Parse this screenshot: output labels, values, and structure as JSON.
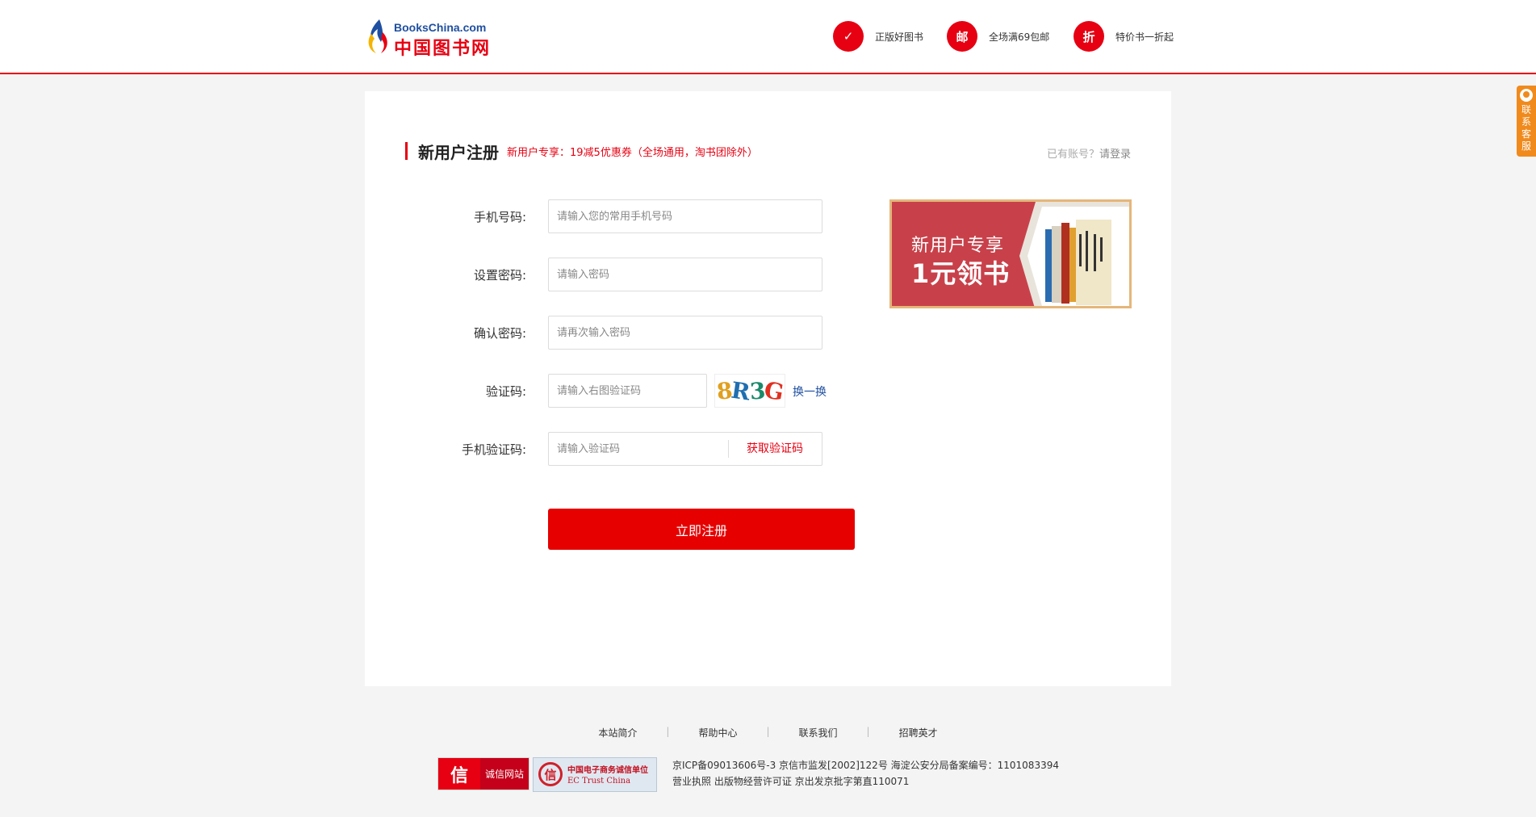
{
  "header": {
    "logo_en": "BooksChina.com",
    "logo_cn": "中国图书网",
    "features": [
      {
        "icon": "check-icon",
        "icon_text": "✓",
        "label": "正版好图书"
      },
      {
        "icon": "mail-icon",
        "icon_text": "邮",
        "label": "全场满69包邮"
      },
      {
        "icon": "discount-icon",
        "icon_text": "折",
        "label": "特价书一折起"
      }
    ]
  },
  "form": {
    "title": "新用户注册",
    "promo": "新用户专享：19减5优惠券（全场通用，淘书团除外）",
    "login_prefix": "已有账号？",
    "login_link": "请登录",
    "fields": {
      "phone": {
        "label": "手机号码:",
        "placeholder": "请输入您的常用手机号码"
      },
      "password": {
        "label": "设置密码:",
        "placeholder": "请输入密码"
      },
      "confirm": {
        "label": "确认密码:",
        "placeholder": "请再次输入密码"
      },
      "captcha": {
        "label": "验证码:",
        "placeholder": "请输入右图验证码",
        "image_text": "8R3G",
        "refresh": "换一换"
      },
      "sms": {
        "label": "手机验证码:",
        "placeholder": "请输入验证码",
        "button": "获取验证码"
      }
    },
    "submit": "立即注册"
  },
  "banner": {
    "line1": "新用户专享",
    "line2": "1元领书"
  },
  "footer": {
    "links": [
      "本站简介",
      "帮助中心",
      "联系我们",
      "招聘英才"
    ],
    "separator": "|",
    "badge1_icon": "信",
    "badge1_label": "诚信网站",
    "badge2_icon": "信",
    "badge2_line1": "中国电子商务诚信单位",
    "badge2_line2": "EC Trust China",
    "line1": "京ICP备09013606号-3   京信市监发[2002]122号   海淀公安分局备案编号：1101083394",
    "line2": "营业执照   出版物经营许可证  京出发京批字第直110071"
  },
  "side_tab": {
    "label": "联系客服"
  },
  "colors": {
    "brand": "#e60012",
    "accent_orange": "#f08a1c",
    "link_blue": "#1f4fa0"
  }
}
